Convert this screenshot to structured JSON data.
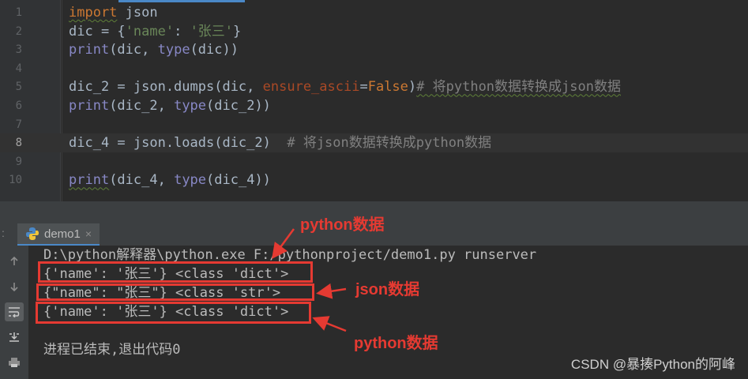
{
  "editor": {
    "lines": [
      {
        "num": "1",
        "segments": [
          {
            "t": "import",
            "c": "kw squig"
          },
          {
            "t": " json",
            "c": ""
          }
        ]
      },
      {
        "num": "2",
        "segments": [
          {
            "t": "dic = {",
            "c": ""
          },
          {
            "t": "'name'",
            "c": "str"
          },
          {
            "t": ": ",
            "c": ""
          },
          {
            "t": "'张三'",
            "c": "str"
          },
          {
            "t": "}",
            "c": ""
          }
        ]
      },
      {
        "num": "3",
        "segments": [
          {
            "t": "print",
            "c": "bi"
          },
          {
            "t": "(dic, ",
            "c": ""
          },
          {
            "t": "type",
            "c": "bi"
          },
          {
            "t": "(dic))",
            "c": ""
          }
        ]
      },
      {
        "num": "4",
        "segments": []
      },
      {
        "num": "5",
        "segments": [
          {
            "t": "dic_2 = json.dumps(dic, ",
            "c": ""
          },
          {
            "t": "ensure_ascii",
            "c": "param"
          },
          {
            "t": "=",
            "c": ""
          },
          {
            "t": "False",
            "c": "kw"
          },
          {
            "t": ")",
            "c": ""
          },
          {
            "t": "# 将python数据转换成json数据",
            "c": "comment squig"
          }
        ]
      },
      {
        "num": "6",
        "segments": [
          {
            "t": "print",
            "c": "bi"
          },
          {
            "t": "(dic_2, ",
            "c": ""
          },
          {
            "t": "type",
            "c": "bi"
          },
          {
            "t": "(dic_2))",
            "c": ""
          }
        ]
      },
      {
        "num": "7",
        "segments": []
      },
      {
        "num": "8",
        "segments": [
          {
            "t": "dic_4 = json.loads(dic_2)  ",
            "c": ""
          },
          {
            "t": "# 将json数据转换成python数据",
            "c": "comment"
          }
        ]
      },
      {
        "num": "9",
        "segments": []
      },
      {
        "num": "10",
        "segments": [
          {
            "t": "print",
            "c": "bi squig"
          },
          {
            "t": "(dic_4, ",
            "c": ""
          },
          {
            "t": "type",
            "c": "bi"
          },
          {
            "t": "(dic_4))",
            "c": ""
          }
        ]
      }
    ],
    "current_line": "8"
  },
  "run_panel": {
    "tab_label": "demo1",
    "tab_close": "×",
    "colon": ":"
  },
  "console": {
    "command": "D:\\python解释器\\python.exe F:/pythonproject/demo1.py runserver",
    "output1": "{'name': '张三'} <class 'dict'>",
    "output2": "{\"name\": \"张三\"} <class 'str'>",
    "output3": "{'name': '张三'} <class 'dict'>",
    "exit_message": "进程已结束,退出代码0"
  },
  "annotations": {
    "label1": "python数据",
    "label2": "json数据",
    "label3": "python数据"
  },
  "watermark": "CSDN @暴揍Python的阿峰",
  "icons": {
    "up": "arrow-up-icon",
    "down": "arrow-down-icon",
    "wrap": "soft-wrap-icon",
    "scroll": "scroll-to-end-icon",
    "print": "print-icon",
    "python": "python-file-icon"
  },
  "colors": {
    "annotation_red": "#e53a32",
    "editor_bg": "#2b2b2b",
    "keyword": "#cc7832",
    "string": "#6a8759",
    "builtin": "#8888c6"
  }
}
